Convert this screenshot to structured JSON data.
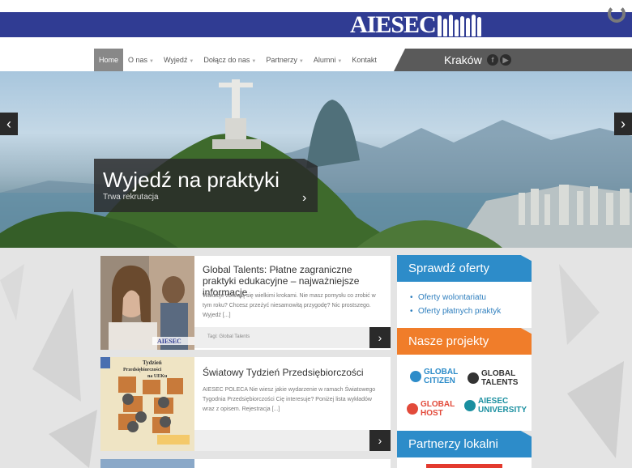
{
  "header": {
    "logo_text": "AIESEC",
    "reload_icon": "reload-icon"
  },
  "nav": {
    "items": [
      {
        "label": "Home",
        "active": true
      },
      {
        "label": "O nas",
        "caret": true
      },
      {
        "label": "Wyjedź",
        "caret": true
      },
      {
        "label": "Dołącz do nas",
        "caret": true
      },
      {
        "label": "Partnerzy",
        "caret": true
      },
      {
        "label": "Alumni",
        "caret": true
      },
      {
        "label": "Kontakt"
      }
    ],
    "city": "Kraków",
    "social": [
      "facebook-icon",
      "youtube-icon"
    ]
  },
  "hero": {
    "title": "Wyjedź na praktyki",
    "subtitle": "Trwa rekrutacja",
    "prev_icon": "chevron-left-icon",
    "next_icon": "chevron-right-icon"
  },
  "articles": [
    {
      "title": "Global Talents: Płatne zagraniczne praktyki edukacyjne – najważniejsze informacje",
      "excerpt": "Wakacje zbliżają się wielkimi krokami. Nie masz pomysłu co zrobić w tym roku? Chcesz przeżyć niesamowitą przygodę? Nic prostszego. Wyjedź [...]",
      "tags": "Tagi: Global Talents",
      "image_text": "AIESEC"
    },
    {
      "title": "Światowy Tydzień Przedsiębiorczości",
      "excerpt": " AIESEC POLECA Nie wiesz jakie wydarzenie w ramach Światowego Tygodnia Przedsiębiorczości Cię interesuje? Poniżej lista wykładów wraz z opisem. Rejestracja [...]",
      "tags": "",
      "image_text": "Tydzień Przedsiębiorczości na UEKu"
    }
  ],
  "sidebar": {
    "offers": {
      "heading": "Sprawdź oferty",
      "links": [
        "Oferty wolontariatu",
        "Oferty płatnych praktyk"
      ],
      "color": "#2d8cc9"
    },
    "projects": {
      "heading": "Nasze projekty",
      "color": "#f07d2a",
      "items": [
        {
          "line1": "GLOBAL",
          "line2": "CITIZEN",
          "color": "#2d8cc9"
        },
        {
          "line1": "GLOBAL",
          "line2": "TALENTS",
          "color": "#333333"
        },
        {
          "line1": "GLOBAL",
          "line2": "HOST",
          "color": "#e24a3a"
        },
        {
          "line1": "AIESEC",
          "line2": "UNIVERSITY",
          "color": "#1a8fa0"
        }
      ]
    },
    "partners": {
      "heading": "Partnerzy lokalni",
      "color": "#2d8cc9"
    }
  }
}
